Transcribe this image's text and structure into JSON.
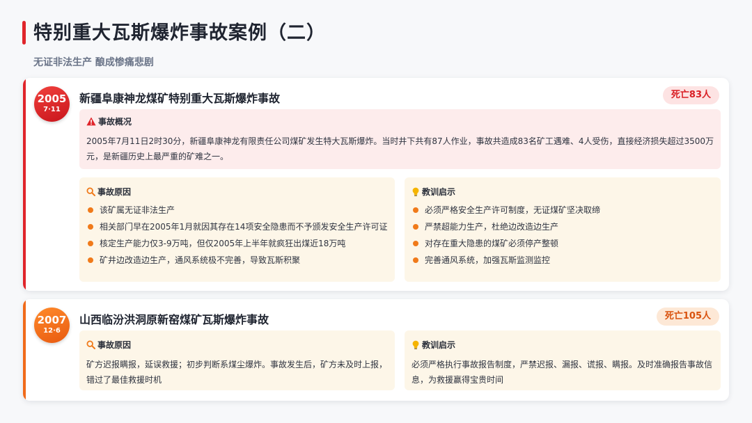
{
  "page": {
    "title": "特别重大瓦斯爆炸事故案例（二）",
    "subtitle": "无证非法生产 酿成惨痛悲剧"
  },
  "colors": {
    "accent_red": "#e0252b",
    "accent_orange": "#f06a1a",
    "overview_bg": "#fdecec",
    "sub_bg": "#fdf6e8",
    "bullet": "#f07a1a"
  },
  "case1": {
    "year": "2005",
    "date": "7·11",
    "title": "新疆阜康神龙煤矿特别重大瓦斯爆炸事故",
    "deaths": "死亡83人",
    "overview": {
      "icon": "warning-icon",
      "heading": "事故概况",
      "text": "2005年7月11日2时30分，新疆阜康神龙有限责任公司煤矿发生特大瓦斯爆炸。当时井下共有87人作业，事故共造成83名矿工遇难、4人受伤，直接经济损失超过3500万元，是新疆历史上最严重的矿难之一。"
    },
    "causes": {
      "icon": "search-icon",
      "heading": "事故原因",
      "items": [
        "该矿属无证非法生产",
        "相关部门早在2005年1月就因其存在14项安全隐患而不予颁发安全生产许可证",
        "核定生产能力仅3-9万吨，但仅2005年上半年就疯狂出煤近18万吨",
        "矿井边改造边生产，通风系统极不完善，导致瓦斯积聚"
      ]
    },
    "lessons": {
      "icon": "lightbulb-icon",
      "heading": "教训启示",
      "items": [
        "必须严格安全生产许可制度，无证煤矿坚决取缔",
        "严禁超能力生产，杜绝边改造边生产",
        "对存在重大隐患的煤矿必须停产整顿",
        "完善通风系统，加强瓦斯监测监控"
      ]
    }
  },
  "case2": {
    "year": "2007",
    "date": "12·6",
    "title": "山西临汾洪洞原新窑煤矿瓦斯爆炸事故",
    "deaths": "死亡105人",
    "causes": {
      "icon": "search-icon",
      "heading": "事故原因",
      "text": "矿方迟报瞒报，延误救援；初步判断系煤尘爆炸。事故发生后，矿方未及时上报，错过了最佳救援时机"
    },
    "lessons": {
      "icon": "lightbulb-icon",
      "heading": "教训启示",
      "text": "必须严格执行事故报告制度，严禁迟报、漏报、谎报、瞒报。及时准确报告事故信息，为救援赢得宝贵时间"
    }
  }
}
